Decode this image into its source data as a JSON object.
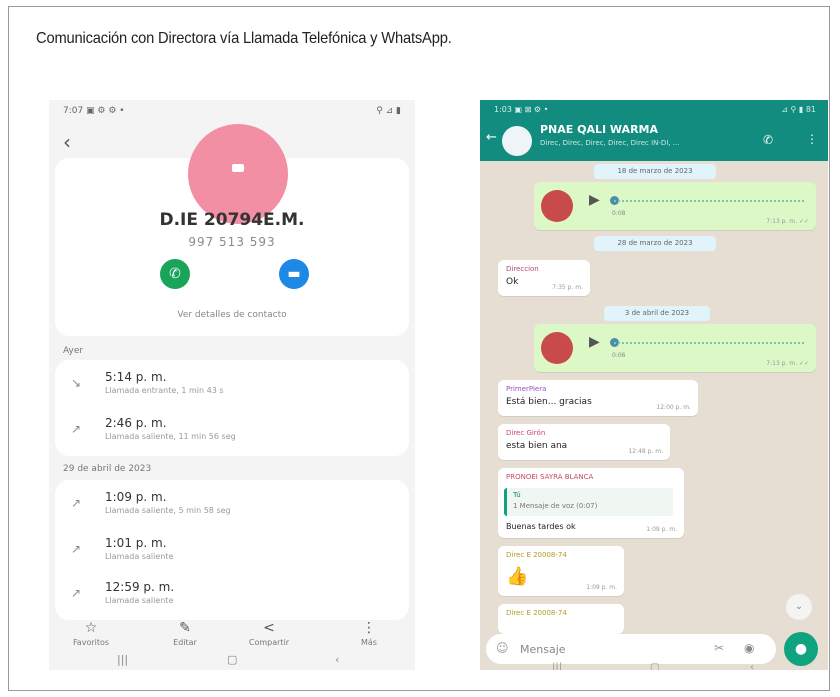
{
  "doc": {
    "title": "Comunicación con Directora vía Llamada Telefónica y WhatsApp."
  },
  "left_phone": {
    "status_time": "7:07 ▣ ⚙ ⚙ •",
    "status_right": "⚲ ⊿ ▮",
    "back_icon": "‹",
    "contact_name": "D.IE 20794E.M.",
    "contact_number": "997 513 593",
    "details_link": "Ver detalles de contacto",
    "section_yesterday": "Ayer",
    "section_date": "29 de abril de 2023",
    "calls": [
      {
        "time": "5:14 p. m.",
        "detail": "Llamada entrante, 1 min 43 s"
      },
      {
        "time": "2:46 p. m.",
        "detail": "Llamada saliente, 11 min 56 seg"
      },
      {
        "time": "1:09 p. m.",
        "detail": "Llamada saliente, 5 min 58 seg"
      },
      {
        "time": "1:01 p. m.",
        "detail": "Llamada saliente"
      },
      {
        "time": "12:59 p. m.",
        "detail": "Llamada saliente"
      }
    ],
    "bottom_actions": [
      {
        "icon": "☆",
        "label": "Favoritos"
      },
      {
        "icon": "✎",
        "label": "Editar"
      },
      {
        "icon": "<",
        "label": "Compartir"
      },
      {
        "icon": "⋮",
        "label": "Más"
      }
    ],
    "nav": [
      "|||",
      "▢",
      "‹"
    ]
  },
  "right_phone": {
    "status_time": "1:03 ▣ ⊠ ⚙ •",
    "status_right": "⊿ ⚲ ▮ 81",
    "group_name": "PNAE QALI WARMA",
    "group_members": "Direc, Direc, Direc, Direc, Direc IN-DI, ...",
    "date1": "18 de marzo de 2023",
    "date2": "28 de marzo de 2023",
    "date3": "3 de abril de 2023",
    "voice1": {
      "duration": "0:08",
      "time": "7:13 p. m. ✓✓"
    },
    "voice2": {
      "duration": "0:06",
      "time": "7:13 p. m. ✓✓"
    },
    "msgs": [
      {
        "name": "Direccion",
        "text": "Ok",
        "time": "7:35 p. m.",
        "name_color": "#b04a7a"
      },
      {
        "name": "PrimerPiera",
        "text": "Está bien... gracias",
        "time": "12:00 p. m.",
        "name_color": "#9b4fc9"
      },
      {
        "name": "Direc Girón",
        "text": "esta bien ana",
        "time": "12:48 p. m.",
        "name_color": "#d2456f"
      },
      {
        "name": "PRONOEI SAYRA BLANCA",
        "quote_name": "Tú",
        "quote_text": "1 Mensaje de voz (0:07)",
        "text": "Buenas tardes ok",
        "time": "1:09 p. m.",
        "name_color": "#c94a66"
      },
      {
        "name": "Direc E 20008-74",
        "text": "👍",
        "time": "1:09 p. m.",
        "name_color": "#b59a22"
      },
      {
        "name": "Direc E 20008-74",
        "text": "",
        "time": "",
        "name_color": "#b59a22"
      }
    ],
    "input_placeholder": "Mensaje",
    "nav": [
      "|||",
      "▢",
      "‹"
    ]
  }
}
